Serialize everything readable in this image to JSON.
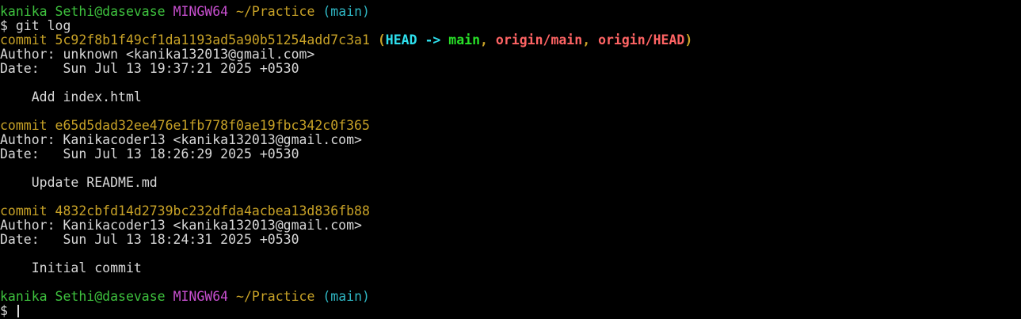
{
  "prompt1": {
    "user_host": "kanika Sethi@dasevase",
    "system": "MINGW64",
    "path": "~/Practice",
    "branch": "(main)"
  },
  "command": {
    "symbol": "$",
    "text": "git log"
  },
  "commits": [
    {
      "commit_label": "commit",
      "hash": "5c92f8b1f49cf1da1193ad5a90b51254add7c3a1",
      "refs": {
        "open": "(",
        "head": "HEAD",
        "arrow": "->",
        "main": "main",
        "sep1": ",",
        "origin_main": "origin/main",
        "sep2": ",",
        "origin_head": "origin/HEAD",
        "close": ")"
      },
      "author_label": "Author:",
      "author": "unknown <kanika132013@gmail.com>",
      "date_label": "Date:",
      "date": "Sun Jul 13 19:37:21 2025 +0530",
      "message": "Add index.html"
    },
    {
      "commit_label": "commit",
      "hash": "e65d5dad32ee476e1fb778f0ae19fbc342c0f365",
      "author_label": "Author:",
      "author": "Kanikacoder13 <kanika132013@gmail.com>",
      "date_label": "Date:",
      "date": "Sun Jul 13 18:26:29 2025 +0530",
      "message": "Update README.md"
    },
    {
      "commit_label": "commit",
      "hash": "4832cbfd14d2739bc232dfda4acbea13d836fb88",
      "author_label": "Author:",
      "author": "Kanikacoder13 <kanika132013@gmail.com>",
      "date_label": "Date:",
      "date": "Sun Jul 13 18:24:31 2025 +0530",
      "message": "Initial commit"
    }
  ],
  "prompt2": {
    "user_host": "kanika Sethi@dasevase",
    "system": "MINGW64",
    "path": "~/Practice",
    "branch": "(main)",
    "symbol": "$"
  },
  "colors": {
    "background": "#000000",
    "user_host": "#3ec23e",
    "system": "#c84fd0",
    "path": "#c8a227",
    "branch": "#2fb7c4",
    "commit": "#c8a227",
    "head_ref": "#2ee0ee",
    "local_branch": "#28e028",
    "remote_branch": "#ff6464"
  }
}
